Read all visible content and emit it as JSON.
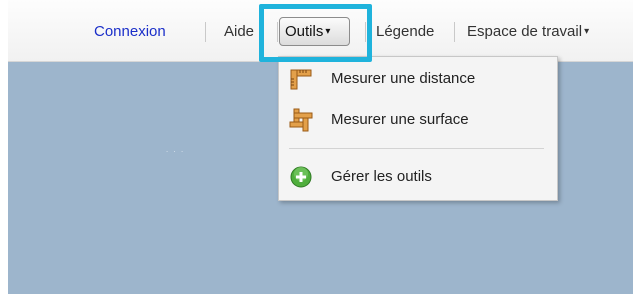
{
  "toolbar": {
    "login_label": "Connexion",
    "help_label": "Aide",
    "tools_label": "Outils",
    "legend_label": "Légende",
    "workspace_label": "Espace de travail",
    "caret": "▾"
  },
  "tools_menu": {
    "items": [
      {
        "label": "Mesurer une distance",
        "icon": "ruler-icon"
      },
      {
        "label": "Mesurer une surface",
        "icon": "area-measure-icon"
      },
      {
        "label": "Gérer les outils",
        "icon": "add-green-icon"
      }
    ]
  },
  "colors": {
    "highlight": "#1fb3dc",
    "link": "#1b2fc9",
    "map_background": "#9db5cc",
    "icon_orange": "#d98a2b",
    "icon_green": "#4fae3c"
  }
}
